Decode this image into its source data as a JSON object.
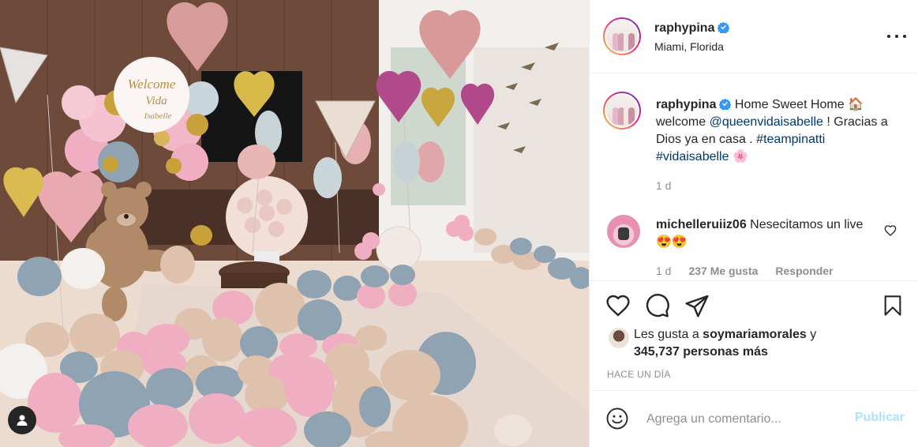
{
  "post": {
    "username": "raphypina",
    "location": "Miami, Florida",
    "verified_icon": "verified-badge-icon",
    "more_icon": "more-options-icon"
  },
  "caption": {
    "username": "raphypina",
    "text_1": "Home Sweet Home 🏠 welcome ",
    "mention": "@queenvidaisabelle",
    "text_2": " ! Gracias a Dios ya en casa . ",
    "hashtag_1": "#teampinatti",
    "hashtag_2": "#vidaisabelle",
    "emoji_end": " 🌸",
    "time": "1 d"
  },
  "comment": {
    "username": "michelleruiiz06",
    "text": "Nesecitamos un live 😍😍",
    "time": "1 d",
    "likes": "237 Me gusta",
    "reply": "Responder"
  },
  "likes": {
    "prefix": "Les gusta a ",
    "first_user": "soymariamorales",
    "middle": " y",
    "count": "345,737 personas más"
  },
  "posted_ago": "HACE UN DÍA",
  "add_comment": {
    "placeholder": "Agrega un comentario...",
    "publish_label": "Publicar"
  },
  "photo": {
    "balloon_text_1": "Welcome",
    "balloon_text_2": "Vida",
    "balloon_text_3": "Isabelle"
  },
  "colors": {
    "link": "#00376b",
    "verified": "#3897f0",
    "publish_disabled": "#b2dffc",
    "secondary_text": "#8e8e8e",
    "balloon_pink": "#f0aec3",
    "balloon_blue": "#8fa3b3",
    "balloon_tan": "#dfc2ad"
  }
}
